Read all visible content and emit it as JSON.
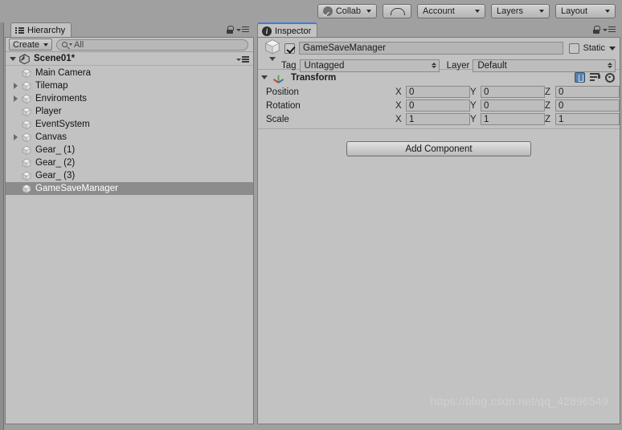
{
  "toolbar": {
    "collab": {
      "label": "Collab",
      "icon": "collab-check-icon"
    },
    "cloud": {
      "icon": "cloud-icon"
    },
    "account": {
      "label": "Account"
    },
    "layers": {
      "label": "Layers"
    },
    "layout": {
      "label": "Layout"
    }
  },
  "hierarchy": {
    "tab_label": "Hierarchy",
    "tab_icon": "hierarchy-icon",
    "create_label": "Create",
    "search_placeholder": "All",
    "search_value": "All",
    "scene_name": "Scene01*",
    "lock_icon": "lock-icon",
    "menu_icon": "panel-menu-icon",
    "items": [
      {
        "label": "Main Camera",
        "depth": 1,
        "expandable": false,
        "selected": false
      },
      {
        "label": "Tilemap",
        "depth": 1,
        "expandable": true,
        "selected": false
      },
      {
        "label": "Enviroments",
        "depth": 1,
        "expandable": true,
        "selected": false
      },
      {
        "label": "Player",
        "depth": 1,
        "expandable": false,
        "selected": false
      },
      {
        "label": "EventSystem",
        "depth": 1,
        "expandable": false,
        "selected": false
      },
      {
        "label": "Canvas",
        "depth": 1,
        "expandable": true,
        "selected": false
      },
      {
        "label": "Gear_ (1)",
        "depth": 1,
        "expandable": false,
        "selected": false
      },
      {
        "label": "Gear_ (2)",
        "depth": 1,
        "expandable": false,
        "selected": false
      },
      {
        "label": "Gear_ (3)",
        "depth": 1,
        "expandable": false,
        "selected": false
      },
      {
        "label": "GameSaveManager",
        "depth": 1,
        "expandable": false,
        "selected": true
      }
    ]
  },
  "inspector": {
    "tab_label": "Inspector",
    "tab_icon": "inspector-info-icon",
    "lock_icon": "lock-icon",
    "menu_icon": "panel-menu-icon",
    "object_name": "GameSaveManager",
    "object_enabled": true,
    "static_label": "Static",
    "static_checked": false,
    "tag_label": "Tag",
    "tag_value": "Untagged",
    "layer_label": "Layer",
    "layer_value": "Default",
    "transform": {
      "title": "Transform",
      "icon": "transform-axis-icon",
      "help_icon": "book-help-icon",
      "preset_icon": "preset-icon",
      "gear_icon": "gear-icon",
      "rows": [
        {
          "name": "Position",
          "x": "0",
          "y": "0",
          "z": "0"
        },
        {
          "name": "Rotation",
          "x": "0",
          "y": "0",
          "z": "0"
        },
        {
          "name": "Scale",
          "x": "1",
          "y": "1",
          "z": "1"
        }
      ],
      "axis_labels": {
        "x": "X",
        "y": "Y",
        "z": "Z"
      }
    },
    "add_component_label": "Add Component"
  },
  "watermark": "https://blog.csdn.net/qq_42896549",
  "colors": {
    "toolbar_bg": "#a0a0a0",
    "panel_bg": "#c2c2c2",
    "selection": "#8c8c8c",
    "field_bg": "#bdbdbd",
    "tab_active_accent": "#3c7fd8",
    "watermark": "#d0d0d0"
  }
}
